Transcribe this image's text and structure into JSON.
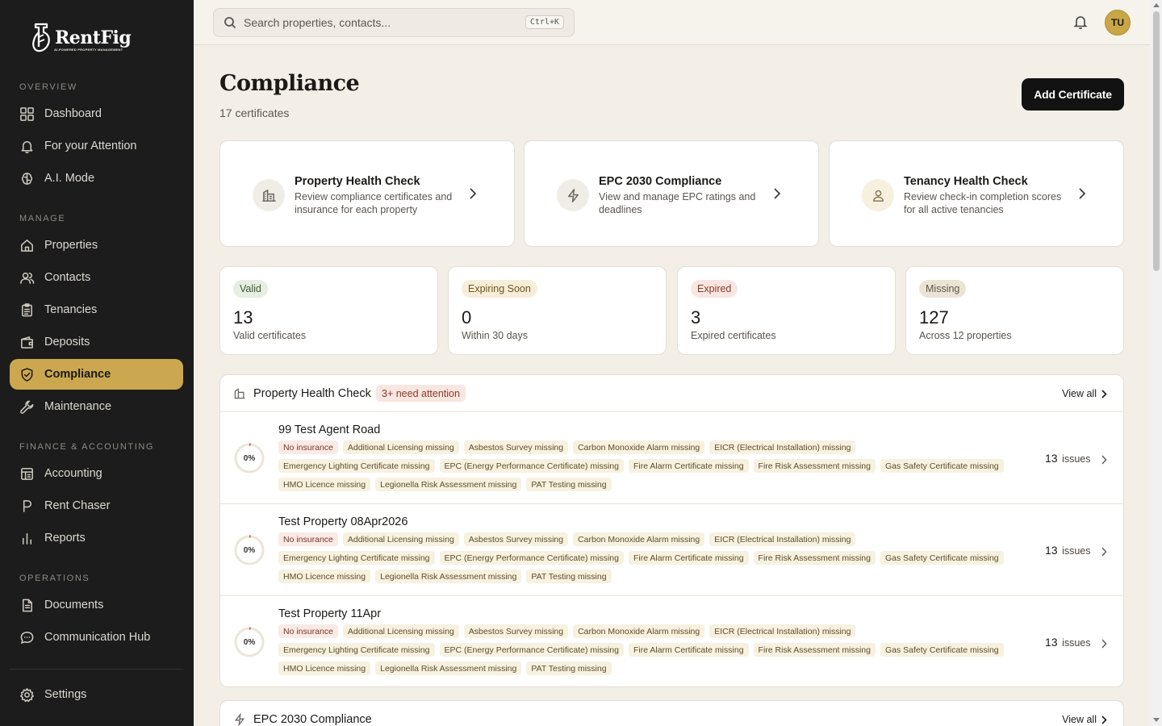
{
  "brand": {
    "name": "RentFig",
    "tagline": "AI-POWERED PROPERTY MANAGEMENT"
  },
  "sidebar": {
    "sections": [
      {
        "label": "OVERVIEW",
        "items": [
          {
            "label": "Dashboard",
            "icon": "grid-icon"
          },
          {
            "label": "For your Attention",
            "icon": "bell-icon"
          },
          {
            "label": "A.I. Mode",
            "icon": "brain-icon"
          }
        ]
      },
      {
        "label": "MANAGE",
        "items": [
          {
            "label": "Properties",
            "icon": "home-icon"
          },
          {
            "label": "Contacts",
            "icon": "users-icon"
          },
          {
            "label": "Tenancies",
            "icon": "clipboard-icon"
          },
          {
            "label": "Deposits",
            "icon": "wallet-icon"
          },
          {
            "label": "Compliance",
            "icon": "shield-check-icon",
            "active": true
          },
          {
            "label": "Maintenance",
            "icon": "wrench-icon"
          }
        ]
      },
      {
        "label": "FINANCE & ACCOUNTING",
        "items": [
          {
            "label": "Accounting",
            "icon": "ledger-icon"
          },
          {
            "label": "Rent Chaser",
            "icon": "pound-icon"
          },
          {
            "label": "Reports",
            "icon": "bar-chart-icon"
          }
        ]
      },
      {
        "label": "OPERATIONS",
        "items": [
          {
            "label": "Documents",
            "icon": "document-icon"
          },
          {
            "label": "Communication Hub",
            "icon": "chat-icon"
          }
        ]
      }
    ],
    "settings": {
      "label": "Settings",
      "icon": "gear-icon"
    }
  },
  "topbar": {
    "search_placeholder": "Search properties, contacts...",
    "shortcut": "Ctrl+K",
    "avatar_initials": "TU"
  },
  "page": {
    "title": "Compliance",
    "subtitle": "17 certificates",
    "add_button": "Add Certificate"
  },
  "quick_cards": [
    {
      "title": "Property Health Check",
      "desc": "Review compliance certificates and insurance for each property",
      "icon": "building-icon"
    },
    {
      "title": "EPC 2030 Compliance",
      "desc": "View and manage EPC ratings and deadlines",
      "icon": "lightning-icon"
    },
    {
      "title": "Tenancy Health Check",
      "desc": "Review check-in completion scores for all active tenancies",
      "icon": "person-icon"
    }
  ],
  "stats": [
    {
      "badge": "Valid",
      "value": "13",
      "label": "Valid certificates",
      "color": "#e5eee1"
    },
    {
      "badge": "Expiring Soon",
      "value": "0",
      "label": "Within 30 days",
      "color": "#f7eed9"
    },
    {
      "badge": "Expired",
      "value": "3",
      "label": "Expired certificates",
      "color": "#f8e6e1"
    },
    {
      "badge": "Missing",
      "value": "127",
      "label": "Across 12 properties",
      "color": "#ebe4d6"
    }
  ],
  "health_panel": {
    "title": "Property Health Check",
    "badge": "3+ need attention",
    "view_all": "View all",
    "rows": [
      {
        "name": "99 Test Agent Road",
        "score": "0%",
        "issues_count": "13",
        "issues_label": "issues"
      },
      {
        "name": "Test Property 08Apr2026",
        "score": "0%",
        "issues_count": "13",
        "issues_label": "issues"
      },
      {
        "name": "Test Property 11Apr",
        "score": "0%",
        "issues_count": "13",
        "issues_label": "issues"
      }
    ],
    "tags": [
      "No insurance",
      "Additional Licensing missing",
      "Asbestos Survey missing",
      "Carbon Monoxide Alarm missing",
      "EICR (Electrical Installation) missing",
      "Emergency Lighting Certificate missing",
      "EPC (Energy Performance Certificate) missing",
      "Fire Alarm Certificate missing",
      "Fire Risk Assessment missing",
      "Gas Safety Certificate missing",
      "HMO Licence missing",
      "Legionella Risk Assessment missing",
      "PAT Testing missing"
    ]
  },
  "epc_panel": {
    "title": "EPC 2030 Compliance",
    "view_all": "View all"
  }
}
